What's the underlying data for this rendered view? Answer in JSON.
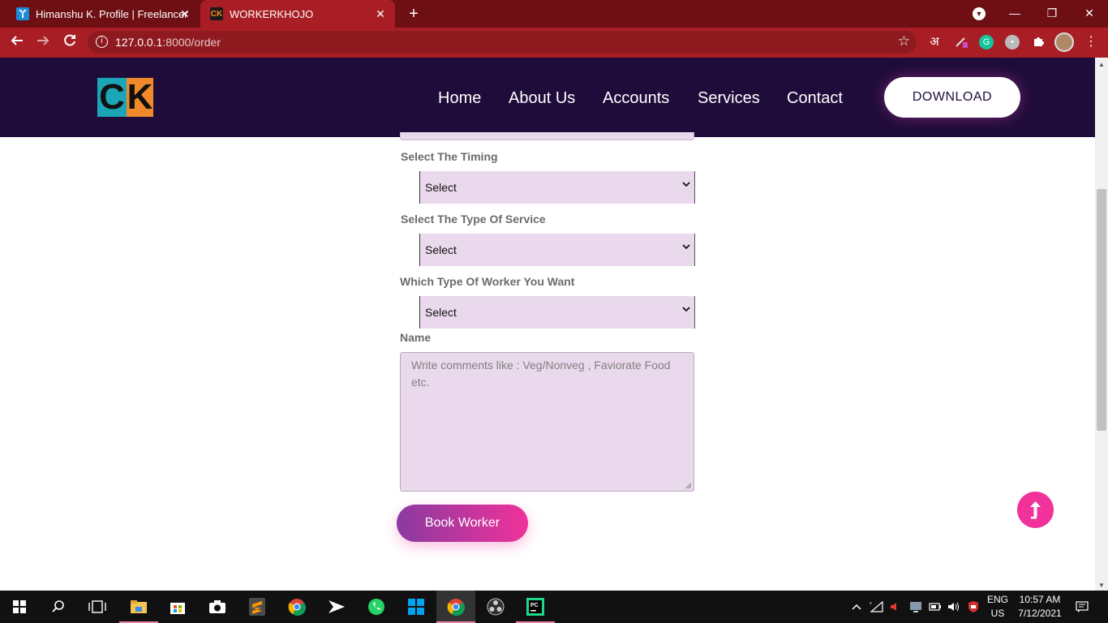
{
  "browser": {
    "tabs": [
      {
        "title": "Himanshu K. Profile | Freelancer",
        "favicon": "freelancer-icon",
        "active": false
      },
      {
        "title": "WORKERKHOJO",
        "favicon": "ck-logo-icon",
        "active": true
      }
    ],
    "url_host": "127.0.0.1",
    "url_path": ":8000/order",
    "ext_hindi": "अ"
  },
  "site": {
    "nav": [
      "Home",
      "About Us",
      "Accounts",
      "Services",
      "Contact"
    ],
    "download_label": "DOWNLOAD",
    "logo_text_c": "C",
    "logo_text_k": "K"
  },
  "form": {
    "timing_label": "Select The Timing",
    "timing_value": "Select",
    "service_label": "Select The Type Of Service",
    "service_value": "Select",
    "worker_label": "Which Type Of Worker You Want",
    "worker_value": "Select",
    "name_label": "Name",
    "comments_placeholder": "Write comments like : Veg/Nonveg , Faviorate Food etc.",
    "submit_label": "Book Worker"
  },
  "taskbar": {
    "lang_line1": "ENG",
    "lang_line2": "US",
    "time": "10:57 AM",
    "date": "7/12/2021"
  },
  "colors": {
    "tabbar": "#6e0f14",
    "toolbar": "#a81e24",
    "header": "#1f0c3a",
    "field_bg": "#ead9ec",
    "accent_pink": "#f0329a",
    "accent_purple": "#8a3aa0"
  }
}
